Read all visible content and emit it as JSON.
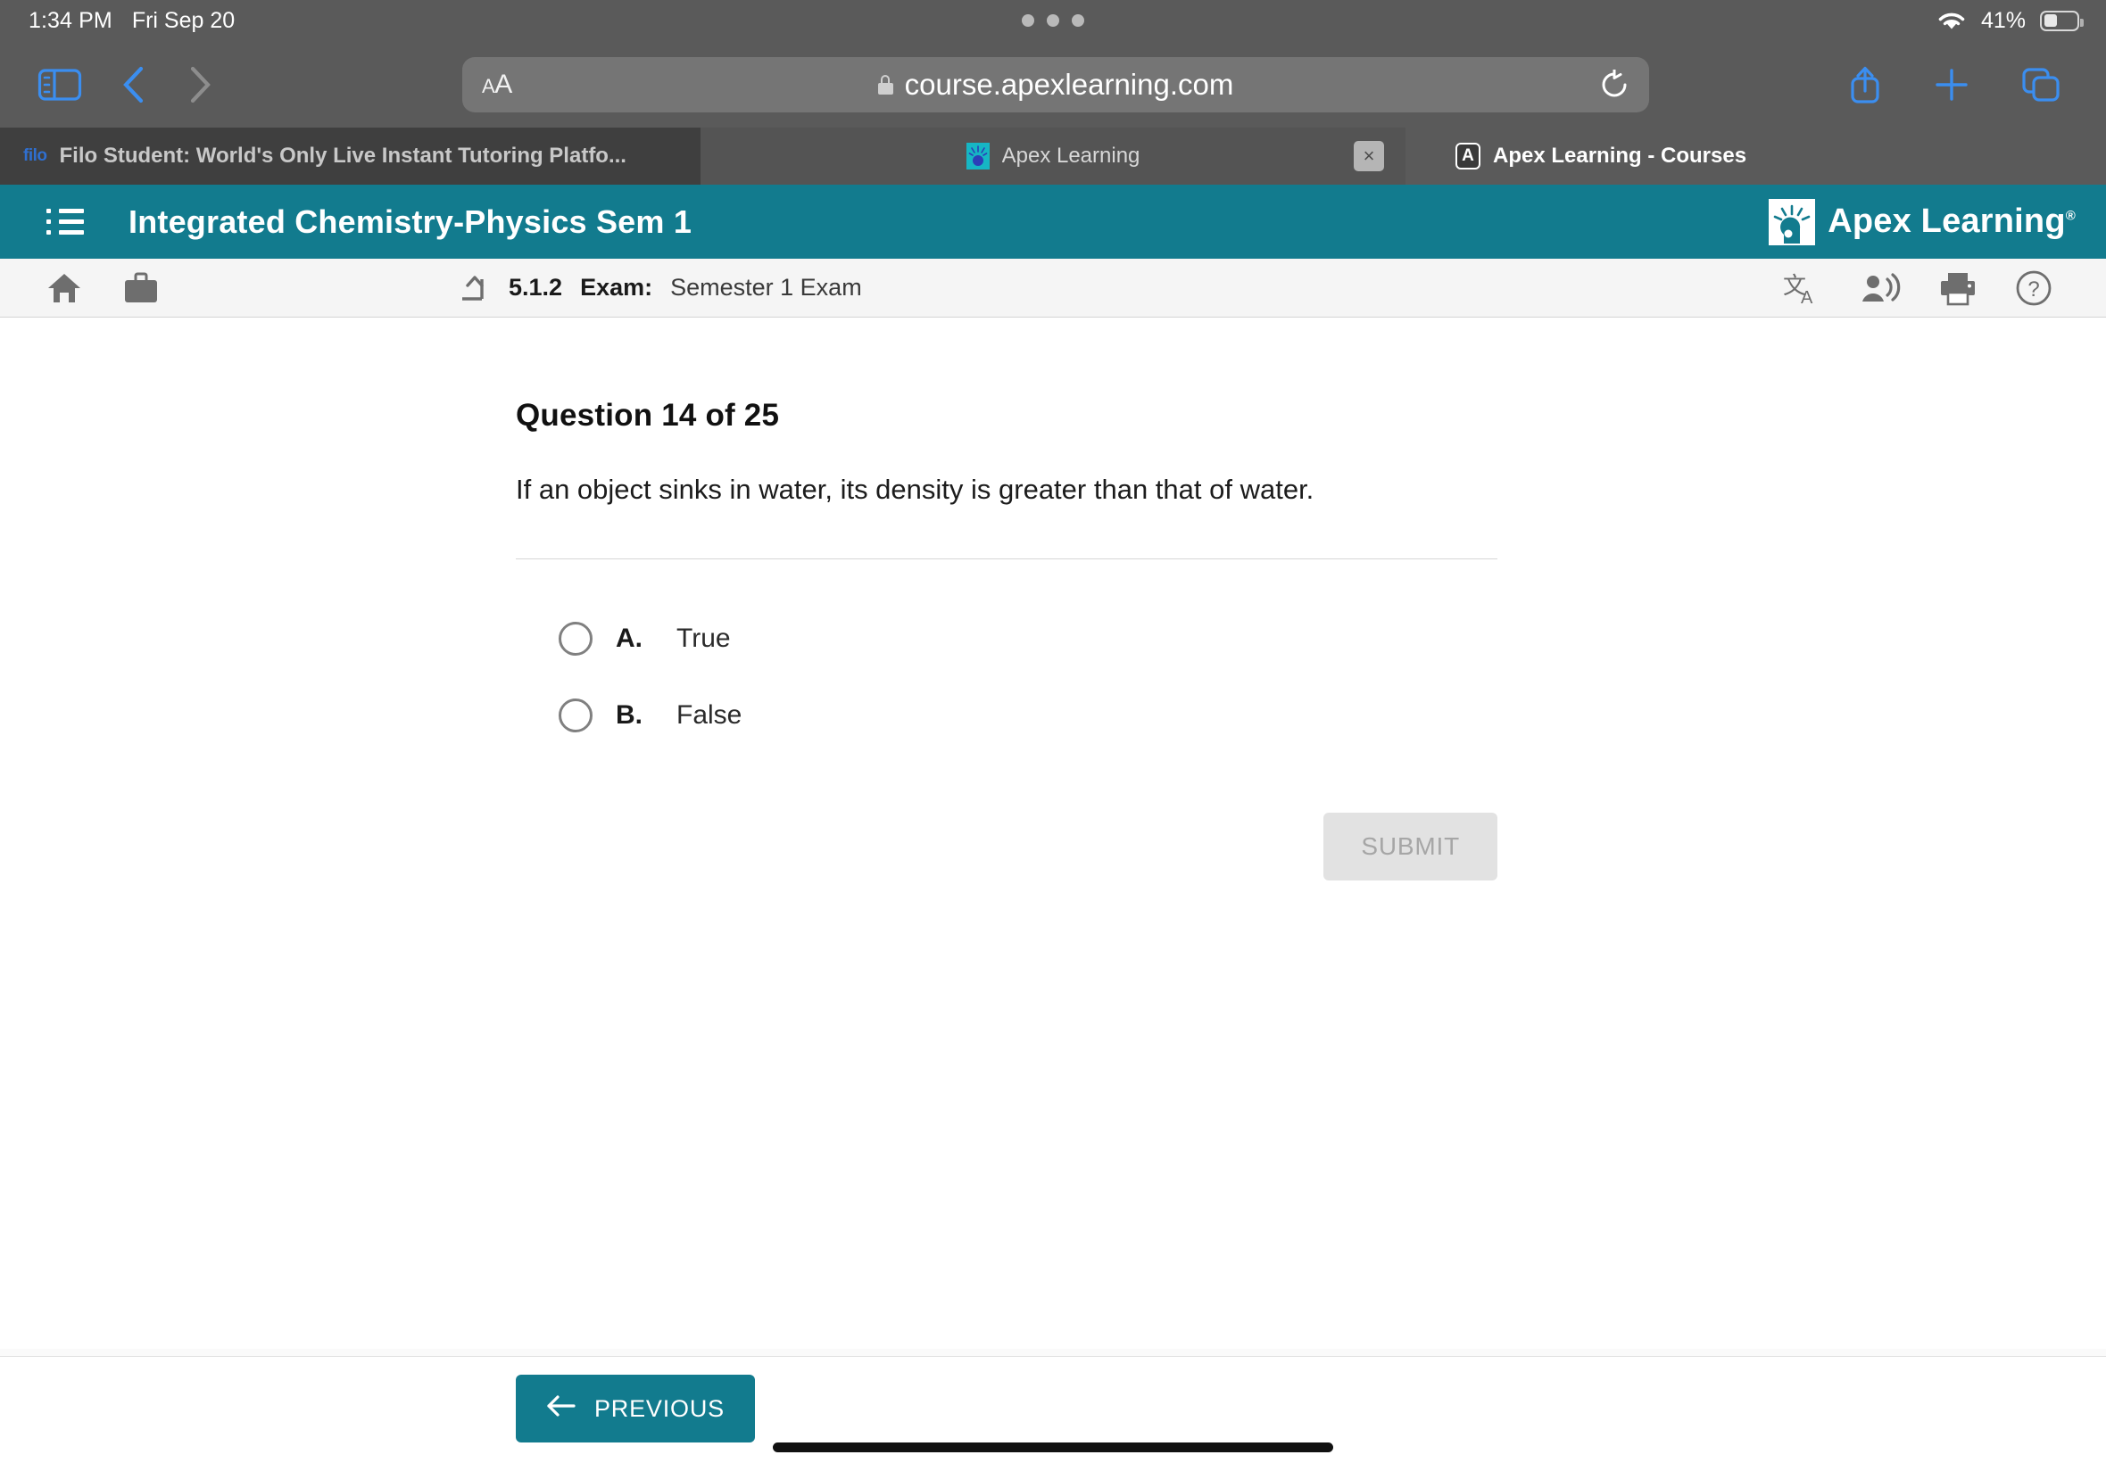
{
  "status_bar": {
    "time": "1:34 PM",
    "date": "Fri Sep 20",
    "battery_percent": "41%",
    "wifi_icon": "wifi-icon",
    "battery_icon": "battery-icon",
    "multitask_dots": "multitask-dots-icon"
  },
  "browser": {
    "sidebar_icon": "sidebar-toggle-icon",
    "back_icon": "back-chevron-icon",
    "forward_icon": "forward-chevron-icon",
    "text_size_label": "AA",
    "lock_icon": "lock-icon",
    "url": "course.apexlearning.com",
    "reload_icon": "reload-icon",
    "share_icon": "share-icon",
    "new_tab_icon": "plus-icon",
    "tabs_overview_icon": "tab-overview-icon",
    "tabs": [
      {
        "title": "Filo Student: World's Only Live Instant Tutoring Platfo...",
        "favicon": "filo-favicon",
        "favicon_text": "filo",
        "active": false,
        "closable": false
      },
      {
        "title": "Apex Learning",
        "favicon": "apex-favicon",
        "favicon_text": "",
        "active": true,
        "closable": true,
        "close_label": "×"
      },
      {
        "title": "Apex Learning - Courses",
        "favicon": "letter-a-favicon",
        "favicon_text": "A",
        "active": false,
        "closable": false
      }
    ]
  },
  "app_header": {
    "menu_icon": "hamburger-menu-icon",
    "course_title": "Integrated Chemistry-Physics Sem 1",
    "logo_text": "Apex Learning",
    "logo_trademark": "®",
    "logo_mark_icon": "apex-lightbulb-head-icon",
    "background_color": "#127b8e"
  },
  "toolbar": {
    "home_icon": "home-icon",
    "briefcase_icon": "briefcase-icon",
    "up_icon": "up-level-arrow-icon",
    "breadcrumb_number": "5.1.2",
    "breadcrumb_type": "Exam:",
    "breadcrumb_name": "Semester 1 Exam",
    "translate_icon": "translate-icon",
    "read_aloud_icon": "read-aloud-icon",
    "print_icon": "print-icon",
    "help_icon": "help-question-icon"
  },
  "question": {
    "heading": "Question 14 of 25",
    "number": 14,
    "total": 25,
    "prompt": "If an object sinks in water, its density is greater than that of water.",
    "choices": [
      {
        "letter": "A.",
        "text": "True",
        "selected": false
      },
      {
        "letter": "B.",
        "text": "False",
        "selected": false
      }
    ],
    "submit_label": "SUBMIT",
    "submit_enabled": false
  },
  "footer": {
    "previous_label": "PREVIOUS",
    "previous_icon": "arrow-left-icon",
    "accent_color": "#127b8e"
  }
}
